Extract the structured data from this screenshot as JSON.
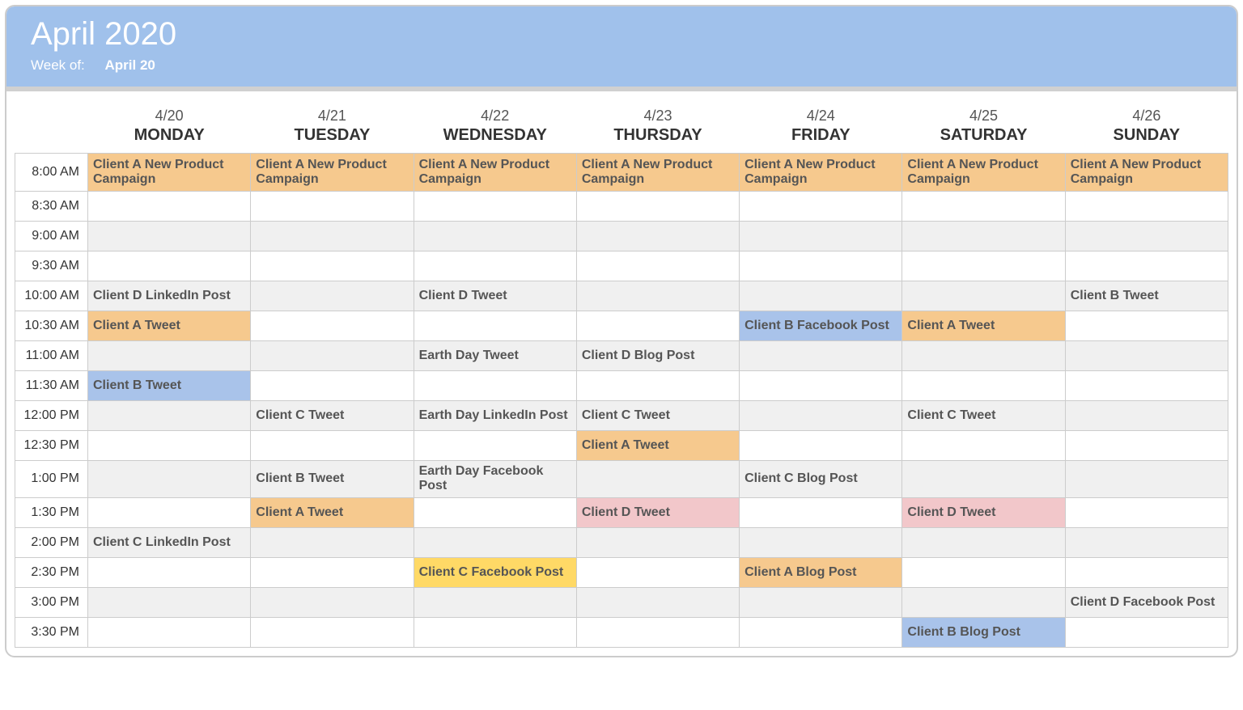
{
  "header": {
    "title": "April 2020",
    "week_label": "Week of:",
    "week_value": "April 20"
  },
  "days": [
    {
      "date": "4/20",
      "name": "MONDAY"
    },
    {
      "date": "4/21",
      "name": "TUESDAY"
    },
    {
      "date": "4/22",
      "name": "WEDNESDAY"
    },
    {
      "date": "4/23",
      "name": "THURSDAY"
    },
    {
      "date": "4/24",
      "name": "FRIDAY"
    },
    {
      "date": "4/25",
      "name": "SATURDAY"
    },
    {
      "date": "4/26",
      "name": "SUNDAY"
    }
  ],
  "times": [
    "8:00 AM",
    "8:30 AM",
    "9:00 AM",
    "9:30 AM",
    "10:00 AM",
    "10:30 AM",
    "11:00 AM",
    "11:30 AM",
    "12:00 PM",
    "12:30 PM",
    "1:00 PM",
    "1:30 PM",
    "2:00 PM",
    "2:30 PM",
    "3:00 PM",
    "3:30 PM"
  ],
  "colors": {
    "orange": "#f6c98e",
    "pink": "#f2c7ca",
    "blue": "#a9c3ea",
    "green": "#b6d7a8",
    "yellow": "#ffd966"
  },
  "events": {
    "8:00 AM": [
      {
        "t": "Client A New Product Campaign",
        "c": "orange"
      },
      {
        "t": "Client A New Product Campaign",
        "c": "orange"
      },
      {
        "t": "Client A New Product Campaign",
        "c": "orange"
      },
      {
        "t": "Client A New Product Campaign",
        "c": "orange"
      },
      {
        "t": "Client A New Product Campaign",
        "c": "orange"
      },
      {
        "t": "Client A New Product Campaign",
        "c": "orange"
      },
      {
        "t": "Client A New Product Campaign",
        "c": "orange"
      }
    ],
    "8:30 AM": [
      null,
      null,
      null,
      null,
      null,
      null,
      null
    ],
    "9:00 AM": [
      null,
      null,
      null,
      null,
      null,
      null,
      null
    ],
    "9:30 AM": [
      null,
      null,
      null,
      null,
      null,
      null,
      null
    ],
    "10:00 AM": [
      {
        "t": "Client D LinkedIn Post",
        "c": "pink"
      },
      null,
      {
        "t": "Client D Tweet",
        "c": "pink"
      },
      null,
      null,
      null,
      {
        "t": "Client B Tweet",
        "c": "blue"
      }
    ],
    "10:30 AM": [
      {
        "t": "Client A Tweet",
        "c": "orange"
      },
      null,
      null,
      null,
      {
        "t": "Client B Facebook Post",
        "c": "blue"
      },
      {
        "t": "Client A Tweet",
        "c": "orange"
      },
      null
    ],
    "11:00 AM": [
      null,
      null,
      {
        "t": "Earth Day Tweet",
        "c": "green"
      },
      {
        "t": "Client D Blog Post",
        "c": "pink"
      },
      null,
      null,
      null
    ],
    "11:30 AM": [
      {
        "t": "Client B Tweet",
        "c": "blue"
      },
      null,
      null,
      null,
      null,
      null,
      null
    ],
    "12:00 PM": [
      null,
      {
        "t": "Client C Tweet",
        "c": "yellow"
      },
      {
        "t": "Earth Day LinkedIn Post",
        "c": "green"
      },
      {
        "t": "Client C Tweet",
        "c": "yellow"
      },
      null,
      {
        "t": "Client C Tweet",
        "c": "yellow"
      },
      null
    ],
    "12:30 PM": [
      null,
      null,
      null,
      {
        "t": "Client A Tweet",
        "c": "orange"
      },
      null,
      null,
      null
    ],
    "1:00 PM": [
      null,
      {
        "t": "Client B Tweet",
        "c": "blue"
      },
      {
        "t": "Earth Day Facebook Post",
        "c": "green"
      },
      null,
      {
        "t": "Client C Blog Post",
        "c": "yellow"
      },
      null,
      null
    ],
    "1:30 PM": [
      null,
      {
        "t": "Client A Tweet",
        "c": "orange"
      },
      null,
      {
        "t": "Client D Tweet",
        "c": "pink"
      },
      null,
      {
        "t": "Client D Tweet",
        "c": "pink"
      },
      null
    ],
    "2:00 PM": [
      {
        "t": "Client C LinkedIn Post",
        "c": "yellow"
      },
      null,
      null,
      null,
      null,
      null,
      null
    ],
    "2:30 PM": [
      null,
      null,
      {
        "t": "Client C Facebook Post",
        "c": "yellow"
      },
      null,
      {
        "t": "Client A Blog Post",
        "c": "orange"
      },
      null,
      null
    ],
    "3:00 PM": [
      null,
      null,
      null,
      null,
      null,
      null,
      {
        "t": "Client D Facebook Post",
        "c": "pink"
      }
    ],
    "3:30 PM": [
      null,
      null,
      null,
      null,
      null,
      {
        "t": "Client B Blog Post",
        "c": "blue"
      },
      null
    ]
  }
}
